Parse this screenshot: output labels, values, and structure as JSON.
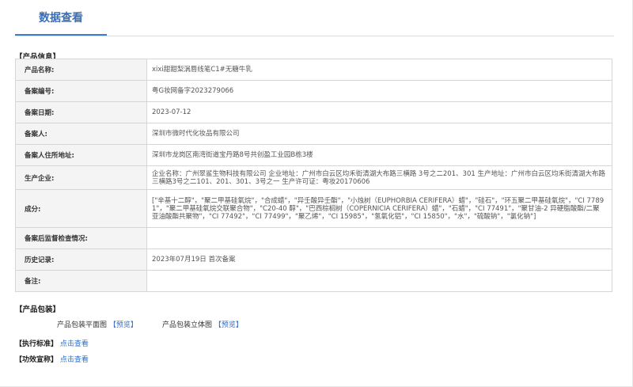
{
  "tabs": {
    "active_label": "数据查看"
  },
  "product_info": {
    "title": "【产品信息】",
    "rows": [
      {
        "label": "产品名称:",
        "value": "xixi甜甜梨涡唇线笔C1#无糖牛乳"
      },
      {
        "label": "备案编号:",
        "value": "粤G妆网备字2023279066"
      },
      {
        "label": "备案日期:",
        "value": "2023-07-12"
      },
      {
        "label": "备案人:",
        "value": "深圳市微时代化妆品有限公司"
      },
      {
        "label": "备案人住所地址:",
        "value": "深圳市龙岗区南湾街道宝丹路8号共创盈工业园B栋3楼"
      },
      {
        "label": "生产企业:",
        "value": "企业名称：广州翠鲨生物科技有限公司 企业地址：广州市白云区均禾街清湖大布路三横路 3号之二201、301 生产地址：广州市白云区均禾街清湖大布路三横路3号之二101、201、301、3号之一 生产许可证：粤妆20170606"
      },
      {
        "label": "成分:",
        "value": "[\"辛基十二醇\"，\"聚二甲基硅氧烷\"，\"合成蜡\"，\"异壬酸异壬酯\"，\"小烛树（EUPHORBIA CERIFERA）蜡\"，\"硅石\"，\"环五聚二甲基硅氧烷\"，\"CI 77891\"，\"聚二甲基硅氧烷交联聚合物\"，\"C20-40 醇\"，\"巴西棕榈树（COPERNICIA CERIFERA）蜡\"，\"石蜡\"，\"CI 77491\"，\"聚甘油-2 异硬脂酸酯/二聚亚油酸酯共聚物\"，\"CI 77492\"，\"CI 77499\"，\"聚乙烯\"，\"CI 15985\"，\"氢氧化铝\"，\"CI 15850\"，\"水\"，\"硫酸钠\"，\"氯化钠\"]"
      },
      {
        "label": "备案后监督检查情况:",
        "value": ""
      },
      {
        "label": "历史记录:",
        "value": "2023年07月19日 首次备案"
      },
      {
        "label": "备注:",
        "value": ""
      }
    ]
  },
  "packaging": {
    "title": "【产品包装】",
    "flat_label": "产品包装平面图",
    "flat_link": "【预览】",
    "solid_label": "产品包装立体图",
    "solid_link": "【预览】"
  },
  "standard": {
    "label": "【执行标准】",
    "link": "点击查看"
  },
  "efficacy": {
    "label": "【功效宣称】",
    "link": "点击查看"
  }
}
